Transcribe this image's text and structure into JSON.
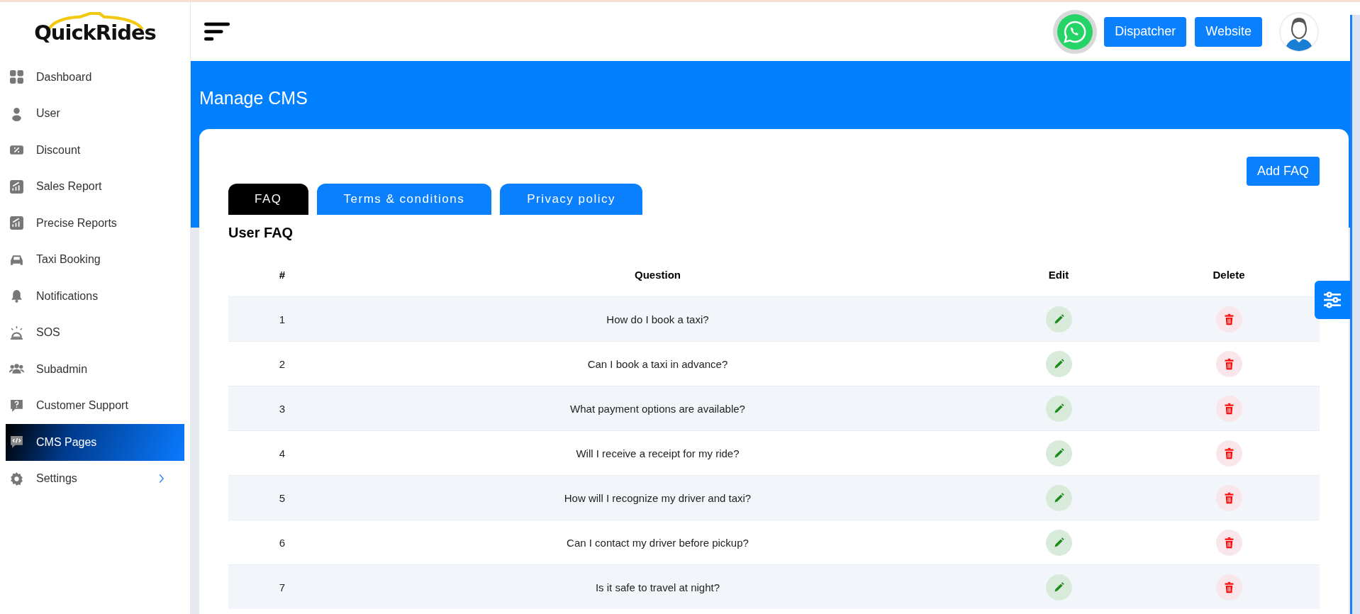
{
  "logo": {
    "text": "QuickRides"
  },
  "sidebar": {
    "items": [
      {
        "label": "Dashboard",
        "selected": false,
        "has_submenu": false
      },
      {
        "label": "User",
        "selected": false,
        "has_submenu": false
      },
      {
        "label": "Discount",
        "selected": false,
        "has_submenu": false
      },
      {
        "label": "Sales Report",
        "selected": false,
        "has_submenu": false
      },
      {
        "label": "Precise Reports",
        "selected": false,
        "has_submenu": false
      },
      {
        "label": "Taxi Booking",
        "selected": false,
        "has_submenu": false
      },
      {
        "label": "Notifications",
        "selected": false,
        "has_submenu": false
      },
      {
        "label": "SOS",
        "selected": false,
        "has_submenu": false
      },
      {
        "label": "Subadmin",
        "selected": false,
        "has_submenu": false
      },
      {
        "label": "Customer Support",
        "selected": false,
        "has_submenu": false
      },
      {
        "label": "CMS Pages",
        "selected": true,
        "has_submenu": false
      },
      {
        "label": "Settings",
        "selected": false,
        "has_submenu": true
      }
    ]
  },
  "topbar": {
    "buttons": [
      "Dispatcher",
      "Website"
    ]
  },
  "page": {
    "title": "Manage CMS",
    "add_button": "Add FAQ",
    "tabs": [
      {
        "label": "FAQ",
        "selected": true
      },
      {
        "label": "Terms & conditions",
        "selected": false
      },
      {
        "label": "Privacy policy",
        "selected": false
      }
    ],
    "section_title": "User FAQ",
    "table": {
      "columns": [
        "#",
        "Question",
        "Edit",
        "Delete"
      ],
      "rows": [
        {
          "number": "1",
          "question": "How do I book a taxi?"
        },
        {
          "number": "2",
          "question": "Can I book a taxi in advance?"
        },
        {
          "number": "3",
          "question": "What payment options are available?"
        },
        {
          "number": "4",
          "question": "Will I receive a receipt for my ride?"
        },
        {
          "number": "5",
          "question": "How will I recognize my driver and taxi?"
        },
        {
          "number": "6",
          "question": "Can I contact my driver before pickup?"
        },
        {
          "number": "7",
          "question": "Is it safe to travel at night?"
        }
      ]
    }
  }
}
